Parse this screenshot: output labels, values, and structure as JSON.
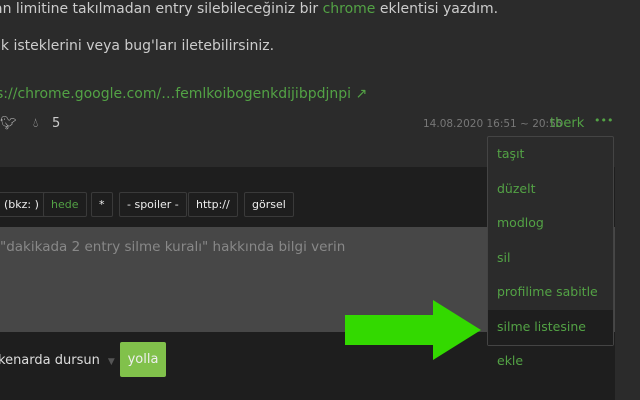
{
  "entry": {
    "line1_pre": "an limitine takılmadan entry silebileceğiniz bir ",
    "line1_link": "chrome",
    "line1_post": " eklentisi yazdım.",
    "line2": "ik isteklerini veya bug'ları iletebilirsiniz.",
    "link": "s://chrome.google.com/…femlkoibogenkdijibpdjnpi",
    "vote_count": "5",
    "date": "14.08.2020 16:51 ~ 20:55",
    "author": "tberk",
    "more": "•••"
  },
  "menu": [
    "taşıt",
    "düzelt",
    "modlog",
    "sil",
    "profilime sabitle",
    "silme listesine ekle"
  ],
  "toolbar": [
    "(bkz: )",
    "hede",
    "*",
    "- spoiler -",
    "http://",
    "görsel"
  ],
  "editor": {
    "placeholder": "\"dakikada 2 entry silme kuralı\" hakkında bilgi verin"
  },
  "footer": {
    "select": "kenarda dursun",
    "submit": "yolla"
  },
  "colors": {
    "accent": "#53a245",
    "arrow": "#33d900",
    "button": "#81c14b"
  }
}
